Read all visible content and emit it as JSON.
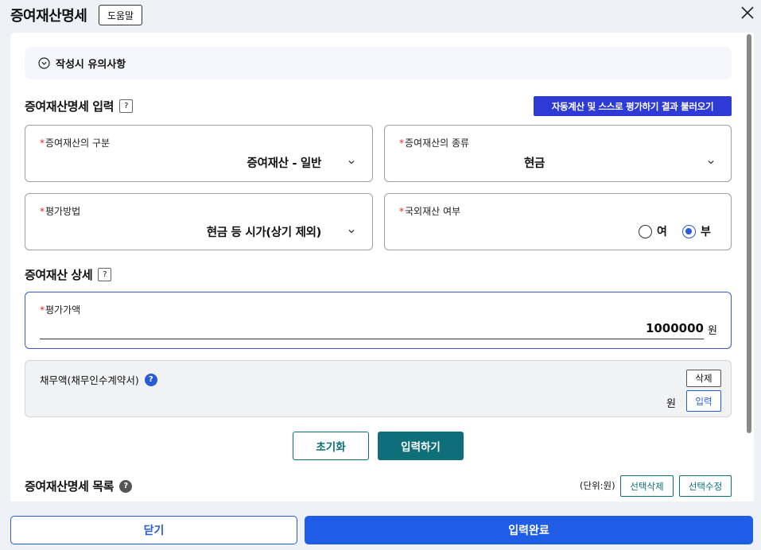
{
  "header": {
    "title": "증여재산명세",
    "help_label": "도움말"
  },
  "notice": {
    "label": "작성시 유의사항"
  },
  "input_section": {
    "title": "증여재산명세 입력",
    "help_glyph": "?",
    "auto_button_label": "자동계산 및 스스로 평가하기 결과 불러오기",
    "required_mark": "*",
    "fields": {
      "category": {
        "label": "증여재산의 구분",
        "value": "증여재산 - 일반"
      },
      "type": {
        "label": "증여재산의 종류",
        "value": "현금"
      },
      "method": {
        "label": "평가방법",
        "value": "현금 등 시가(상기 제외)"
      },
      "foreign": {
        "label": "국외재산 여부",
        "options": [
          "여",
          "부"
        ],
        "selected": "부"
      }
    }
  },
  "detail_section": {
    "title": "증여재산 상세",
    "help_glyph": "?",
    "amount": {
      "label": "평가가액",
      "value": "1000000",
      "unit": "원"
    },
    "debt": {
      "label": "채무액(채무인수계약서)",
      "help_glyph": "?",
      "delete_label": "삭제",
      "unit": "원",
      "input_label": "입력"
    },
    "reset_label": "초기화",
    "submit_label": "입력하기"
  },
  "list_section": {
    "title": "증여재산명세 목록",
    "help_glyph": "?",
    "unit_note": "(단위:원)",
    "delete_selected_label": "선택삭제",
    "edit_selected_label": "선택수정"
  },
  "footer": {
    "close_label": "닫기",
    "complete_label": "입력완료"
  },
  "colors": {
    "primary_blue": "#1f5de6",
    "auto_button": "#2d3ad6",
    "teal": "#0e6f7a",
    "required_red": "#e0262d"
  }
}
